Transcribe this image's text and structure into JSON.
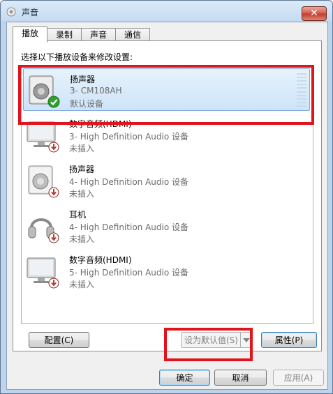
{
  "window": {
    "title": "声音",
    "close_glyph": "✕"
  },
  "tabs": [
    {
      "label": "播放"
    },
    {
      "label": "录制"
    },
    {
      "label": "声音"
    },
    {
      "label": "通信"
    }
  ],
  "instruction": "选择以下播放设备来修改设置:",
  "devices": [
    {
      "name": "扬声器",
      "desc": "3- CM108AH",
      "status": "默认设备",
      "icon": "speaker-icon",
      "badge": "default-check-icon"
    },
    {
      "name": "数字音频(HDMI)",
      "desc": "3- High Definition Audio 设备",
      "status": "未插入",
      "icon": "monitor-icon",
      "badge": "unplugged-icon"
    },
    {
      "name": "扬声器",
      "desc": "4- High Definition Audio 设备",
      "status": "未插入",
      "icon": "speaker-icon",
      "badge": "unplugged-icon"
    },
    {
      "name": "耳机",
      "desc": "4- High Definition Audio 设备",
      "status": "未插入",
      "icon": "headphones-icon",
      "badge": "unplugged-icon"
    },
    {
      "name": "数字音频(HDMI)",
      "desc": "5- High Definition Audio 设备",
      "status": "未插入",
      "icon": "monitor-icon",
      "badge": "unplugged-icon"
    }
  ],
  "buttons": {
    "configure": "配置(C)",
    "set_default": "设为默认值(S)",
    "properties": "属性(P)",
    "ok": "确定",
    "cancel": "取消",
    "apply": "应用(A)"
  },
  "colors": {
    "highlight": "#e1141c",
    "selection": "#cde4f8",
    "default_check": "#2fa12f",
    "unplugged": "#c0392b"
  }
}
